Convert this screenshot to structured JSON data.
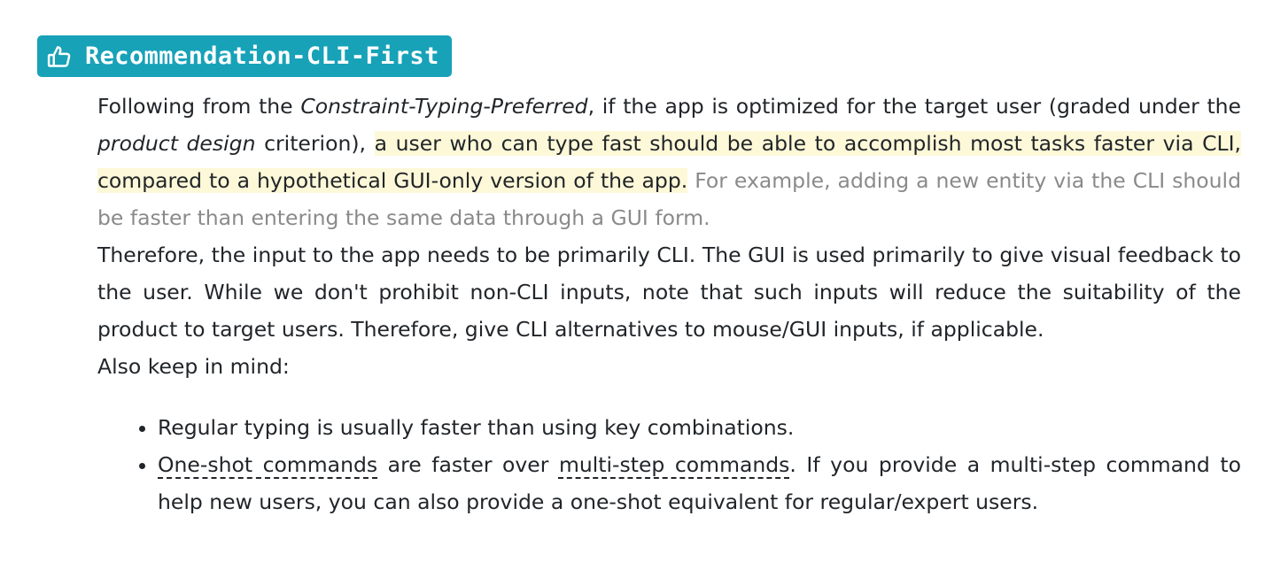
{
  "heading": {
    "icon": "thumbs-up-icon",
    "title": "Recommendation-CLI-First",
    "badge_color": "#17a2b8"
  },
  "paragraph1": {
    "p1": "Following from the ",
    "em1": "Constraint-Typing-Preferred",
    "p2": ", if the app is optimized for the target user (graded under the ",
    "em2": "product design",
    "p3": " criterion), ",
    "highlight": "a user who can type fast should be able to accomplish most tasks faster via CLI, compared to a hypothetical GUI-only version of the app.",
    "example": "For example, adding a new entity via the CLI should be faster than entering the same data through a GUI form."
  },
  "paragraph2": "Therefore, the input to the app needs to be primarily CLI. The GUI is used primarily to give visual feedback to the user. While we don't prohibit non-CLI inputs, note that such inputs will reduce the suitability of the product to target users. Therefore, give CLI alternatives to mouse/GUI inputs, if applicable.",
  "paragraph3": "Also keep in mind:",
  "bullets": {
    "item1": "Regular typing is usually faster than using key combinations.",
    "item2": {
      "term1": "One-shot commands",
      "text1": " are faster over ",
      "term2": "multi-step commands",
      "text2": ". If you provide a multi-step command to help new users, you can also provide a one-shot equivalent for regular/expert users."
    }
  },
  "colors": {
    "highlight_bg": "#fdf8d8",
    "muted_text": "#8a8a8a"
  }
}
